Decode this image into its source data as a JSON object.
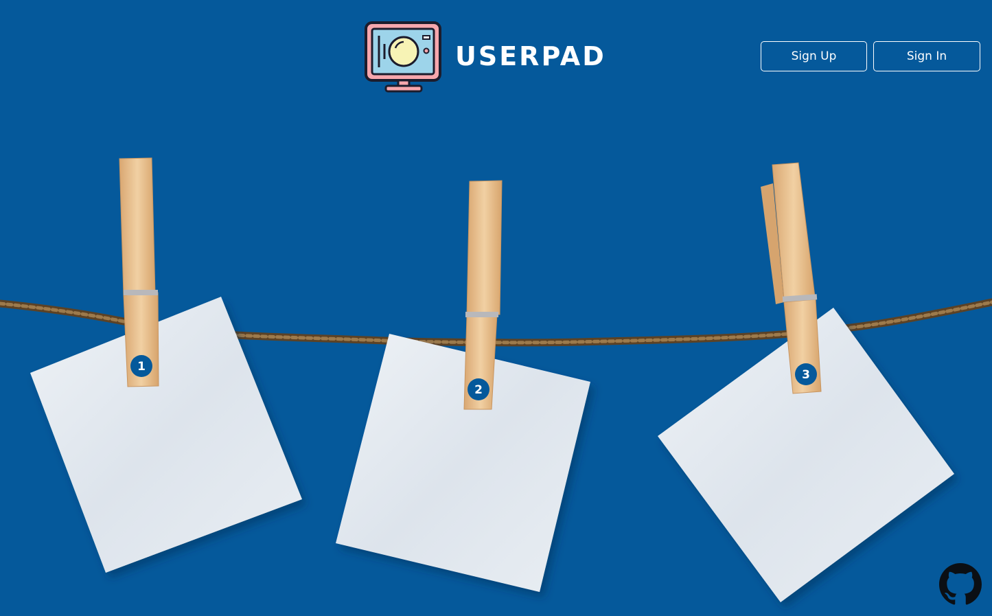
{
  "brand": {
    "name": "USERPAD",
    "icon": "monitor-logo-icon"
  },
  "nav": {
    "signup_label": "Sign Up",
    "signin_label": "Sign In"
  },
  "notes": [
    {
      "label": "1"
    },
    {
      "label": "2"
    },
    {
      "label": "3"
    }
  ],
  "footer": {
    "icon": "github-icon"
  },
  "colors": {
    "background": "#05599b",
    "button_border": "#ffffff",
    "note_paper": "#e4e9ee",
    "clothespin": "#e9c393",
    "badge": "#05599b"
  }
}
